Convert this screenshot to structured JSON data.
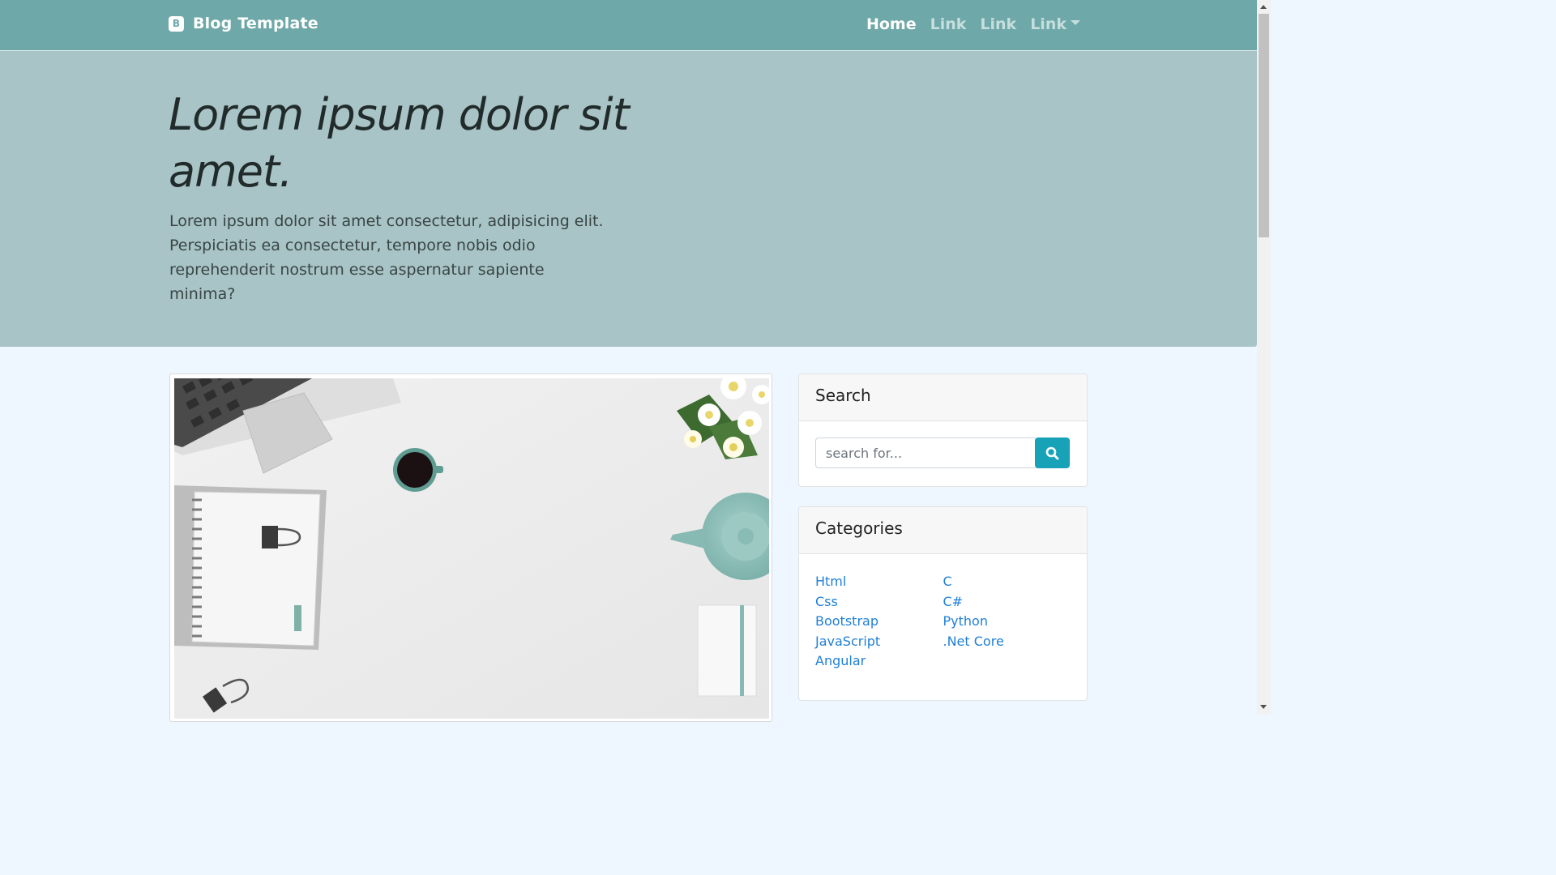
{
  "navbar": {
    "brand_icon_letter": "B",
    "brand_title": "Blog Template",
    "links": [
      {
        "label": "Home",
        "active": true
      },
      {
        "label": "Link",
        "active": false
      },
      {
        "label": "Link",
        "active": false
      },
      {
        "label": "Link",
        "active": false,
        "dropdown": true
      }
    ]
  },
  "hero": {
    "title": "Lorem ipsum dolor sit amet.",
    "lead": "Lorem ipsum dolor sit amet consectetur, adipisicing elit. Perspiciatis ea consectetur, tempore nobis odio reprehenderit nostrum esse aspernatur sapiente minima?"
  },
  "sidebar": {
    "search": {
      "title": "Search",
      "placeholder": "search for...",
      "button_icon": "search-icon"
    },
    "categories": {
      "title": "Categories",
      "left": [
        "Html",
        "Css",
        "Bootstrap",
        "JavaScript",
        "Angular"
      ],
      "right": [
        "C",
        "C#",
        "Python",
        ".Net Core"
      ]
    }
  },
  "colors": {
    "navbar": "#6ea8a8",
    "hero": "#a8c4c6",
    "page_bg": "#eef7ff",
    "link": "#1f7fd6",
    "search_button": "#17a2b8"
  }
}
